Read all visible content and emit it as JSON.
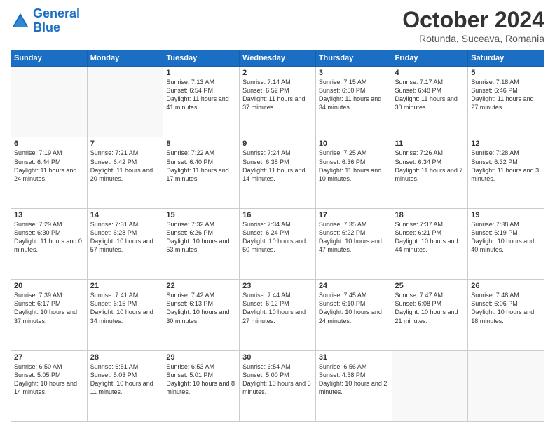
{
  "header": {
    "logo_line1": "General",
    "logo_line2": "Blue",
    "month": "October 2024",
    "location": "Rotunda, Suceava, Romania"
  },
  "weekdays": [
    "Sunday",
    "Monday",
    "Tuesday",
    "Wednesday",
    "Thursday",
    "Friday",
    "Saturday"
  ],
  "weeks": [
    [
      {
        "day": "",
        "info": ""
      },
      {
        "day": "",
        "info": ""
      },
      {
        "day": "1",
        "info": "Sunrise: 7:13 AM\nSunset: 6:54 PM\nDaylight: 11 hours and 41 minutes."
      },
      {
        "day": "2",
        "info": "Sunrise: 7:14 AM\nSunset: 6:52 PM\nDaylight: 11 hours and 37 minutes."
      },
      {
        "day": "3",
        "info": "Sunrise: 7:15 AM\nSunset: 6:50 PM\nDaylight: 11 hours and 34 minutes."
      },
      {
        "day": "4",
        "info": "Sunrise: 7:17 AM\nSunset: 6:48 PM\nDaylight: 11 hours and 30 minutes."
      },
      {
        "day": "5",
        "info": "Sunrise: 7:18 AM\nSunset: 6:46 PM\nDaylight: 11 hours and 27 minutes."
      }
    ],
    [
      {
        "day": "6",
        "info": "Sunrise: 7:19 AM\nSunset: 6:44 PM\nDaylight: 11 hours and 24 minutes."
      },
      {
        "day": "7",
        "info": "Sunrise: 7:21 AM\nSunset: 6:42 PM\nDaylight: 11 hours and 20 minutes."
      },
      {
        "day": "8",
        "info": "Sunrise: 7:22 AM\nSunset: 6:40 PM\nDaylight: 11 hours and 17 minutes."
      },
      {
        "day": "9",
        "info": "Sunrise: 7:24 AM\nSunset: 6:38 PM\nDaylight: 11 hours and 14 minutes."
      },
      {
        "day": "10",
        "info": "Sunrise: 7:25 AM\nSunset: 6:36 PM\nDaylight: 11 hours and 10 minutes."
      },
      {
        "day": "11",
        "info": "Sunrise: 7:26 AM\nSunset: 6:34 PM\nDaylight: 11 hours and 7 minutes."
      },
      {
        "day": "12",
        "info": "Sunrise: 7:28 AM\nSunset: 6:32 PM\nDaylight: 11 hours and 3 minutes."
      }
    ],
    [
      {
        "day": "13",
        "info": "Sunrise: 7:29 AM\nSunset: 6:30 PM\nDaylight: 11 hours and 0 minutes."
      },
      {
        "day": "14",
        "info": "Sunrise: 7:31 AM\nSunset: 6:28 PM\nDaylight: 10 hours and 57 minutes."
      },
      {
        "day": "15",
        "info": "Sunrise: 7:32 AM\nSunset: 6:26 PM\nDaylight: 10 hours and 53 minutes."
      },
      {
        "day": "16",
        "info": "Sunrise: 7:34 AM\nSunset: 6:24 PM\nDaylight: 10 hours and 50 minutes."
      },
      {
        "day": "17",
        "info": "Sunrise: 7:35 AM\nSunset: 6:22 PM\nDaylight: 10 hours and 47 minutes."
      },
      {
        "day": "18",
        "info": "Sunrise: 7:37 AM\nSunset: 6:21 PM\nDaylight: 10 hours and 44 minutes."
      },
      {
        "day": "19",
        "info": "Sunrise: 7:38 AM\nSunset: 6:19 PM\nDaylight: 10 hours and 40 minutes."
      }
    ],
    [
      {
        "day": "20",
        "info": "Sunrise: 7:39 AM\nSunset: 6:17 PM\nDaylight: 10 hours and 37 minutes."
      },
      {
        "day": "21",
        "info": "Sunrise: 7:41 AM\nSunset: 6:15 PM\nDaylight: 10 hours and 34 minutes."
      },
      {
        "day": "22",
        "info": "Sunrise: 7:42 AM\nSunset: 6:13 PM\nDaylight: 10 hours and 30 minutes."
      },
      {
        "day": "23",
        "info": "Sunrise: 7:44 AM\nSunset: 6:12 PM\nDaylight: 10 hours and 27 minutes."
      },
      {
        "day": "24",
        "info": "Sunrise: 7:45 AM\nSunset: 6:10 PM\nDaylight: 10 hours and 24 minutes."
      },
      {
        "day": "25",
        "info": "Sunrise: 7:47 AM\nSunset: 6:08 PM\nDaylight: 10 hours and 21 minutes."
      },
      {
        "day": "26",
        "info": "Sunrise: 7:48 AM\nSunset: 6:06 PM\nDaylight: 10 hours and 18 minutes."
      }
    ],
    [
      {
        "day": "27",
        "info": "Sunrise: 6:50 AM\nSunset: 5:05 PM\nDaylight: 10 hours and 14 minutes."
      },
      {
        "day": "28",
        "info": "Sunrise: 6:51 AM\nSunset: 5:03 PM\nDaylight: 10 hours and 11 minutes."
      },
      {
        "day": "29",
        "info": "Sunrise: 6:53 AM\nSunset: 5:01 PM\nDaylight: 10 hours and 8 minutes."
      },
      {
        "day": "30",
        "info": "Sunrise: 6:54 AM\nSunset: 5:00 PM\nDaylight: 10 hours and 5 minutes."
      },
      {
        "day": "31",
        "info": "Sunrise: 6:56 AM\nSunset: 4:58 PM\nDaylight: 10 hours and 2 minutes."
      },
      {
        "day": "",
        "info": ""
      },
      {
        "day": "",
        "info": ""
      }
    ]
  ]
}
